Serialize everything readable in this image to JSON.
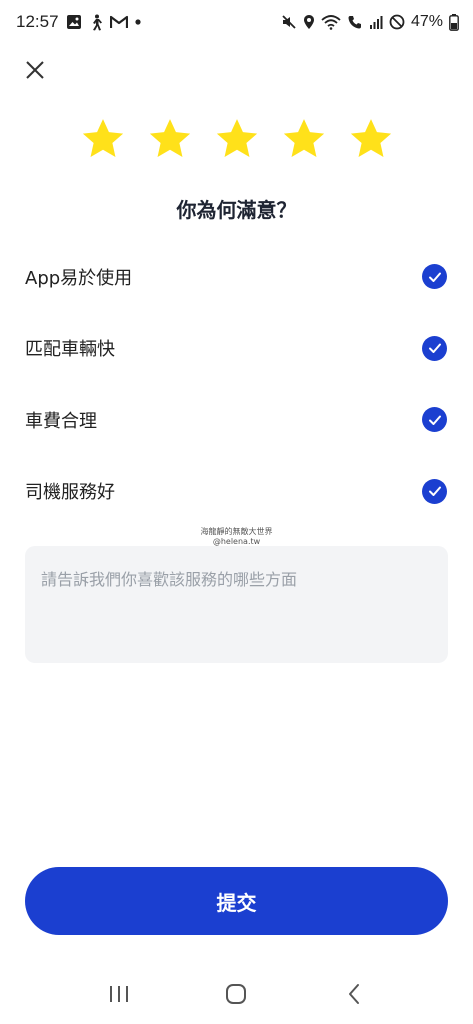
{
  "status_bar": {
    "time": "12:57",
    "battery": "47%",
    "left_icons": [
      "gallery-icon",
      "walking-icon",
      "gmail-icon",
      "notification-dot-icon"
    ],
    "right_icons": [
      "mute-icon",
      "location-icon",
      "wifi-calling-icon",
      "hd-call-icon",
      "signal-icon",
      "do-not-disturb-icon",
      "battery-icon"
    ]
  },
  "header": {
    "close_icon": "close-icon"
  },
  "rating": {
    "value": 5,
    "max": 5,
    "star_color": "#FFE11A"
  },
  "question": "你為何滿意？",
  "reasons": [
    {
      "label": "App易於使用",
      "checked": true
    },
    {
      "label": "匹配車輛快",
      "checked": true
    },
    {
      "label": "車費合理",
      "checked": true
    },
    {
      "label": "司機服務好",
      "checked": true
    }
  ],
  "watermark": {
    "line1": "海龍靜的無敵大世界",
    "line2": "@helena.tw"
  },
  "feedback": {
    "placeholder": "請告訴我們你喜歡該服務的哪些方面"
  },
  "submit": {
    "label": "提交"
  },
  "colors": {
    "accent": "#1B3FD0",
    "star": "#FFE11A",
    "input_bg": "#F3F4F6"
  },
  "nav_bar": {
    "icons": [
      "recents-icon",
      "home-icon",
      "back-icon"
    ]
  }
}
